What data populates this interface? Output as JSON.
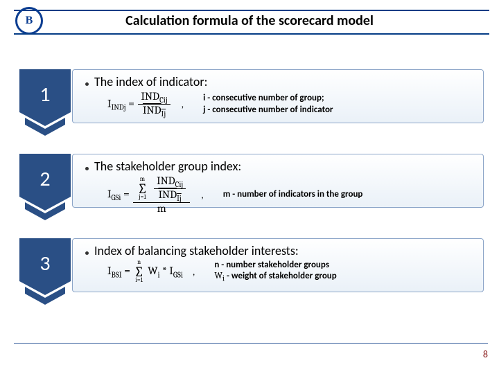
{
  "logo_text": "B",
  "title": "Calculation formula of the scorecard model",
  "page_number": "8",
  "blocks": [
    {
      "num": "1",
      "heading": "The index of indicator:",
      "legend": "i - consecutive number of group;\nj - consecutive number of indicator"
    },
    {
      "num": "2",
      "heading": "The stakeholder group index:",
      "legend": "m - number of indicators in the group"
    },
    {
      "num": "3",
      "heading": "Index of balancing stakeholder interests:",
      "legend_prefix": "n - number stakeholder groups",
      "legend_w_label": " - weight of stakeholder group"
    }
  ],
  "formulas": {
    "f1_lhs": "I",
    "f1_lhs_sub": "INDj",
    "f1_num": "IND",
    "f1_num_sub": "Cij",
    "f1_den": "IND",
    "f1_den_sub": "Ij",
    "f2_lhs": "I",
    "f2_lhs_sub": "GSi",
    "f2_sum_from": "j=1",
    "f2_sum_to": "m",
    "f2_num": "IND",
    "f2_num_sub": "Cij",
    "f2_den": "IND",
    "f2_den_sub": "Ij",
    "f2_outer_den": "m",
    "f3_lhs": "I",
    "f3_lhs_sub": "BSI",
    "f3_sum_from": "i=1",
    "f3_sum_to": "n",
    "f3_rhs_w": "W",
    "f3_rhs_w_sub": "i",
    "f3_rhs_i": "I",
    "f3_rhs_i_sub": "GSi",
    "legend_w": "W",
    "legend_w_sub": "i"
  }
}
